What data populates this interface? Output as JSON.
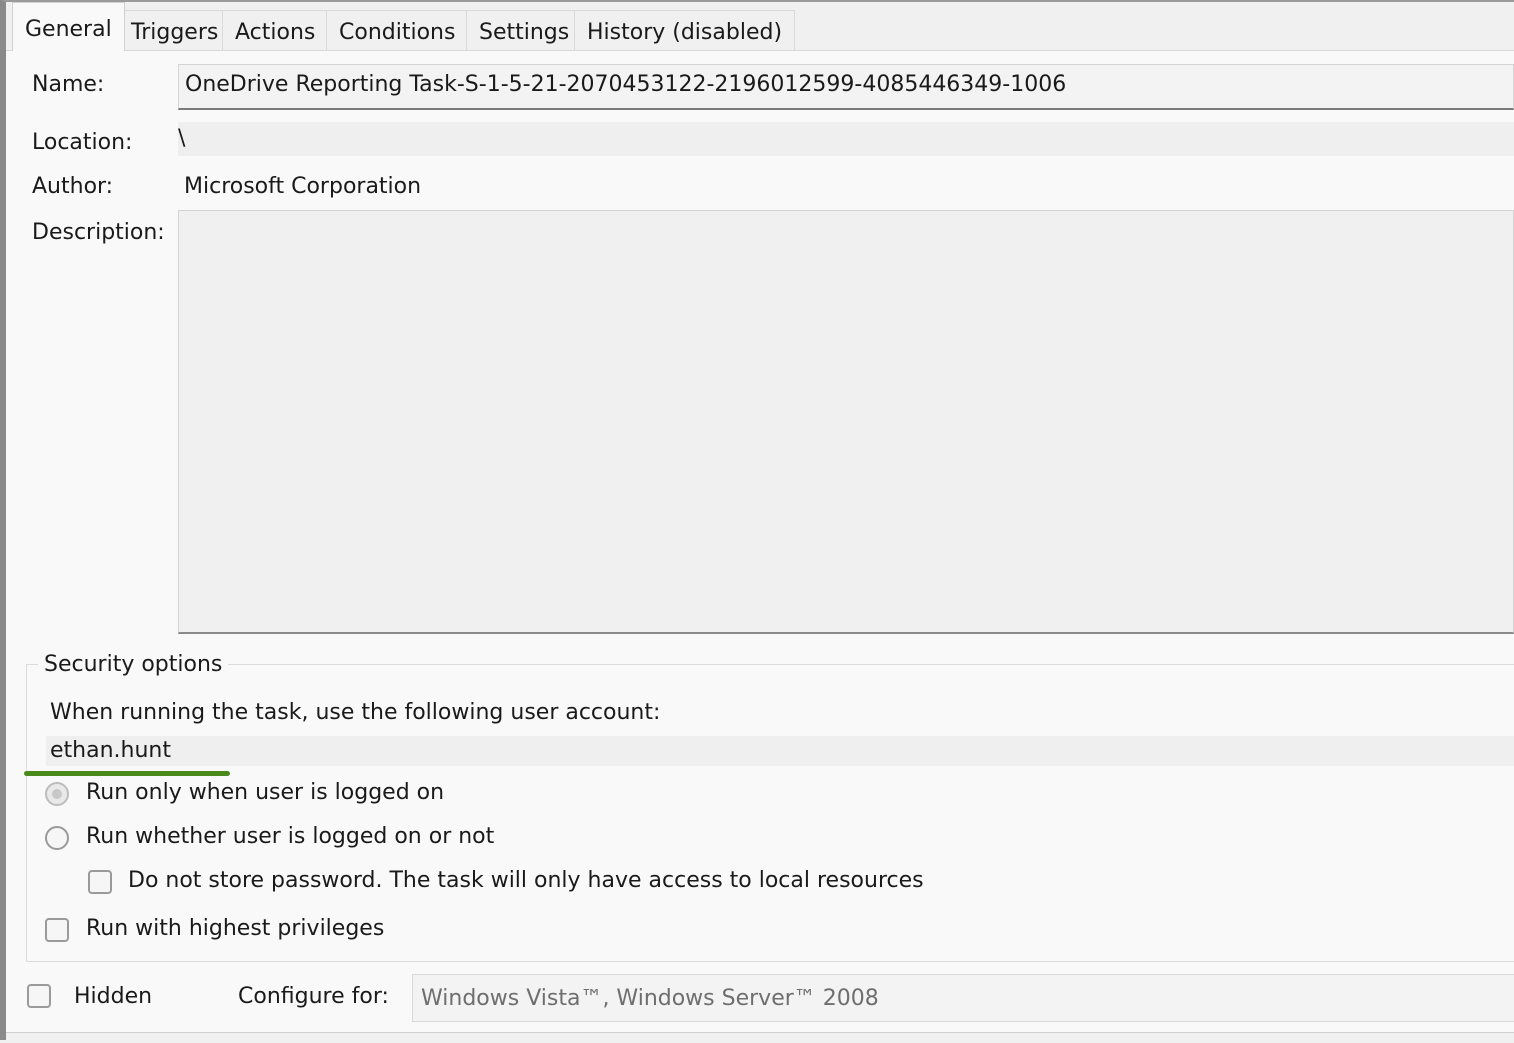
{
  "tabs": [
    {
      "label": "General",
      "active": true
    },
    {
      "label": "Triggers",
      "active": false
    },
    {
      "label": "Actions",
      "active": false
    },
    {
      "label": "Conditions",
      "active": false
    },
    {
      "label": "Settings",
      "active": false
    },
    {
      "label": "History (disabled)",
      "active": false
    }
  ],
  "general": {
    "name_label": "Name:",
    "name_value": "OneDrive Reporting Task-S-1-5-21-2070453122-2196012599-4085446349-1006",
    "location_label": "Location:",
    "location_value": "\\",
    "author_label": "Author:",
    "author_value": "Microsoft Corporation",
    "description_label": "Description:",
    "description_value": ""
  },
  "security": {
    "title": "Security options",
    "account_prompt": "When running the task, use the following user account:",
    "account_value": "ethan.hunt",
    "highlight_color": "#4a8a1c",
    "run_logged_on_label": "Run only when user is logged on",
    "run_logged_on_selected": true,
    "run_whether_label": "Run whether user is logged on or not",
    "run_whether_selected": false,
    "no_store_password_label": "Do not store password.  The task will only have access to local resources",
    "no_store_password_checked": false,
    "highest_privileges_label": "Run with highest privileges",
    "highest_privileges_checked": false
  },
  "footer": {
    "hidden_label": "Hidden",
    "hidden_checked": false,
    "configure_label": "Configure for:",
    "configure_value": "Windows Vista™, Windows Server™ 2008"
  }
}
